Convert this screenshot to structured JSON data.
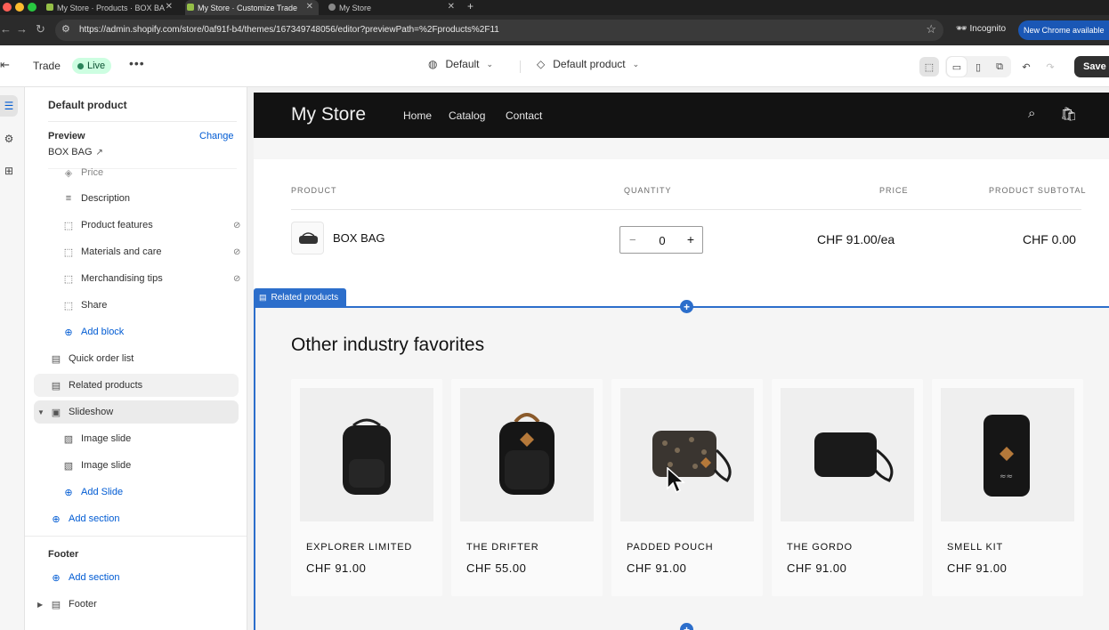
{
  "browser": {
    "tabs": [
      {
        "title": "My Store · Products · BOX BA"
      },
      {
        "title": "My Store · Customize Trade"
      },
      {
        "title": "My Store"
      }
    ],
    "url": "https://admin.shopify.com/store/0af91f-b4/themes/167349748056/editor?previewPath=%2Fproducts%2F11",
    "incognito_label": "Incognito",
    "update_label": "New Chrome available"
  },
  "editor": {
    "theme_name": "Trade",
    "status": "Live",
    "template_selector": "Default",
    "page_selector": "Default product",
    "save_label": "Save"
  },
  "sidebar": {
    "title": "Default product",
    "preview_label": "Preview",
    "change_label": "Change",
    "preview_product": "BOX BAG",
    "items": [
      {
        "label": "Price"
      },
      {
        "label": "Description"
      },
      {
        "label": "Product features"
      },
      {
        "label": "Materials and care"
      },
      {
        "label": "Merchandising tips"
      },
      {
        "label": "Share"
      },
      {
        "label": "Add block"
      },
      {
        "label": "Quick order list"
      },
      {
        "label": "Related products"
      },
      {
        "label": "Slideshow"
      },
      {
        "label": "Image slide"
      },
      {
        "label": "Image slide"
      },
      {
        "label": "Add Slide"
      },
      {
        "label": "Add section"
      }
    ],
    "footer_heading": "Footer",
    "footer_add_section": "Add section",
    "footer_item": "Footer"
  },
  "store": {
    "name": "My Store",
    "nav": [
      "Home",
      "Catalog",
      "Contact"
    ],
    "table_headers": [
      "PRODUCT",
      "QUANTITY",
      "PRICE",
      "PRODUCT SUBTOTAL"
    ],
    "line_item": {
      "name": "BOX BAG",
      "quantity": "0",
      "price": "CHF 91.00/ea",
      "subtotal": "CHF 0.00"
    },
    "related_tag": "Related products",
    "related_heading": "Other industry favorites",
    "products": [
      {
        "name": "EXPLORER LIMITED",
        "price": "CHF 91.00"
      },
      {
        "name": "THE DRIFTER",
        "price": "CHF 55.00"
      },
      {
        "name": "PADDED POUCH",
        "price": "CHF 91.00"
      },
      {
        "name": "THE GORDO",
        "price": "CHF 91.00"
      },
      {
        "name": "SMELL KIT",
        "price": "CHF 91.00"
      }
    ]
  }
}
